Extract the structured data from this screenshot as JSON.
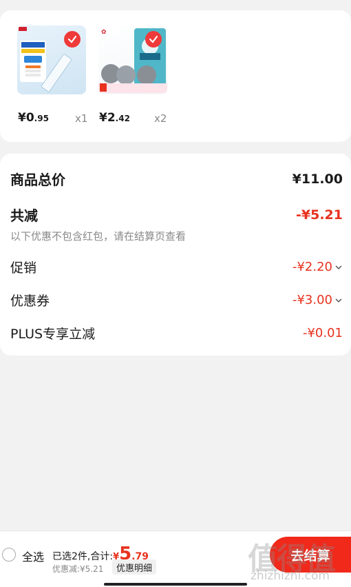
{
  "products": [
    {
      "image": "ruler-product-image",
      "price_int": "¥0",
      "price_dec": ".95",
      "qty": "x1"
    },
    {
      "image": "steel-wool-product-image",
      "price_int": "¥2",
      "price_dec": ".42",
      "qty": "x2"
    }
  ],
  "summary": {
    "total_label": "商品总价",
    "total_value": "¥11.00",
    "discount_label": "共减",
    "discount_value": "-¥5.21",
    "note": "以下优惠不包含红包，请在结算页查看",
    "promo_label": "促销",
    "promo_value": "-¥2.20",
    "coupon_label": "优惠券",
    "coupon_value": "-¥3.00",
    "plus_label": "PLUS专享立减",
    "plus_value": "-¥0.01"
  },
  "bottom": {
    "select_all": "全选",
    "selected_text": "已选2件,合计:",
    "total_yen": "¥",
    "total_int": "5",
    "total_dec": ".79",
    "discount_text": "优惠减:¥5.21",
    "detail_button": "优惠明细",
    "checkout_button": "去结算",
    "watermark": "值得值",
    "watermark_url": "zhizhizhi.com"
  },
  "colors": {
    "accent_red": "#e8321e",
    "checkout_red": "#f0291b"
  }
}
